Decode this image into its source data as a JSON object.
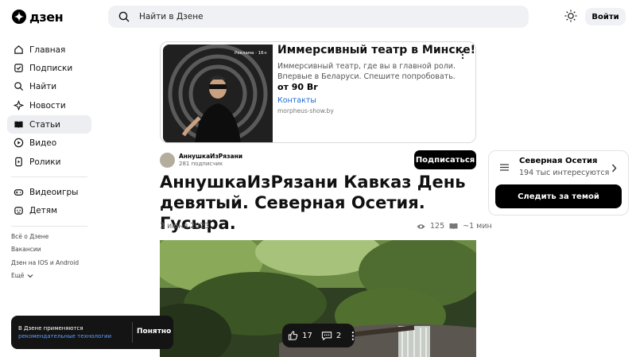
{
  "header": {
    "logo_text": "дзен",
    "search_placeholder": "Найти в Дзене",
    "login_label": "Войти"
  },
  "sidebar": {
    "items": [
      {
        "label": "Главная",
        "icon": "home-icon"
      },
      {
        "label": "Подписки",
        "icon": "subscriptions-icon"
      },
      {
        "label": "Найти",
        "icon": "search-icon"
      },
      {
        "label": "Новости",
        "icon": "news-icon"
      },
      {
        "label": "Статьи",
        "icon": "articles-icon",
        "active": true
      },
      {
        "label": "Видео",
        "icon": "video-icon"
      },
      {
        "label": "Ролики",
        "icon": "shorts-icon"
      },
      {
        "label": "Видеоигры",
        "icon": "gamepad-icon"
      },
      {
        "label": "Детям",
        "icon": "kids-icon"
      }
    ],
    "links": [
      "Всё о Дзене",
      "Вакансии",
      "Дзен на IOS и Android",
      "Ещё"
    ]
  },
  "ad": {
    "badge": "Реклама · 16+",
    "title": "Иммерсивный театр в Минске!",
    "text": "Иммерсивный театр, где вы в главной роли. Впервые в Беларуси. Спешите попробовать.",
    "price": "от 90 Br",
    "link": "Контакты",
    "domain": "morpheus-show.by"
  },
  "article": {
    "author": "АннушкаИзРязани",
    "subscribers": "281 подписчик",
    "subscribe_label": "Подписаться",
    "title": "АннушкаИзРязани Кавказ День девятый. Северная Осетия. Гусыра.",
    "date": "3 июня 2023",
    "views": "125",
    "read_time": "~1 мин"
  },
  "topic": {
    "name": "Северная Осетия",
    "count": "194 тыс интересуются",
    "follow_label": "Следить за темой"
  },
  "cookie": {
    "text": "В Дзене применяются",
    "link": "рекомендательные технологии",
    "button": "Понятно"
  },
  "reactions": {
    "likes": "17",
    "comments": "2"
  }
}
